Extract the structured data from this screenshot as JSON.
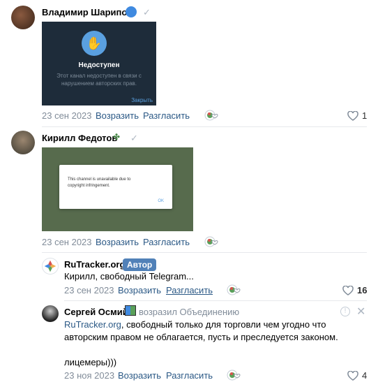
{
  "comment1": {
    "author": "Владимир Шарипов",
    "image": {
      "title": "Недоступен",
      "body": "Этот канал недоступен в связи с нарушением авторских прав.",
      "close": "Закрыть"
    },
    "date": "23 сен 2023",
    "reply": "Возразить",
    "share": "Разгласить",
    "likes": "1"
  },
  "comment2": {
    "author": "Кирилл Федотов",
    "image": {
      "body": "This channel is unavailable due to copyright infringement.",
      "ok": "OK"
    },
    "date": "23 сен 2023",
    "reply": "Возразить",
    "share": "Разгласить"
  },
  "reply1": {
    "author": "RuTracker.org",
    "badge": "Автор",
    "text": "Кирилл, свободный Telegram...",
    "date": "23 сен 2023",
    "reply": "Возразить",
    "share": "Разгласить",
    "likes": "16"
  },
  "reply2": {
    "author": "Сергей Осмий",
    "replied_to": "возразил Объединению",
    "mention": "RuTracker.org",
    "text_line1": ", свободный только для торговли чем угодно что",
    "text_line2": "авторским правом не облагается, пусть и преследуется законом.",
    "text_line3": "лицемеры)))",
    "date": "23 ноя 2023",
    "reply": "Возразить",
    "share": "Разгласить",
    "likes": "4"
  },
  "colors": {
    "link": "#2a5885",
    "meta": "#818c99",
    "badge": "#5181b8"
  }
}
